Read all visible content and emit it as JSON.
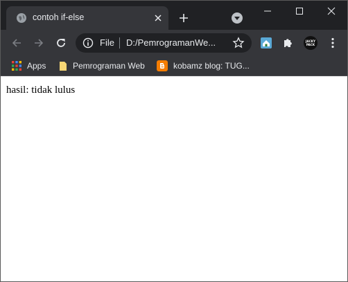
{
  "window": {
    "title": "contoh if-else"
  },
  "tab": {
    "title": "contoh if-else",
    "favicon": "globe-icon"
  },
  "toolbar": {
    "address_scheme": "File",
    "address_url": "D:/PemrogramanWe...",
    "extensions": [
      "home-icon",
      "puzzle-icon",
      "profile-avatar"
    ]
  },
  "bookmarks": [
    {
      "label": "Apps",
      "icon": "apps-grid-icon"
    },
    {
      "label": "Pemrograman Web",
      "icon": "folder-icon"
    },
    {
      "label": "kobamz blog: TUG...",
      "icon": "blogger-icon"
    }
  ],
  "avatar": {
    "text_line1": "JACKY",
    "text_line2": "PACK"
  },
  "page": {
    "text": "hasil: tidak lulus"
  },
  "colors": {
    "titlebar": "#202124",
    "toolbar": "#35363a",
    "blogger": "#f57d00",
    "folder": "#f8d775"
  }
}
